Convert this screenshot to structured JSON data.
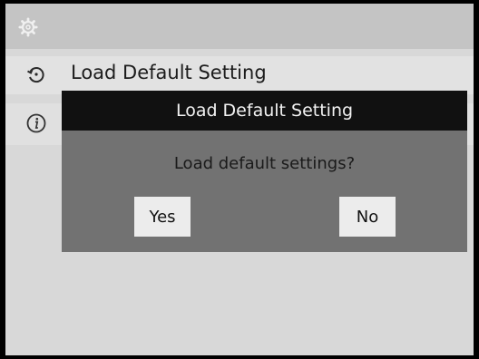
{
  "menu": {
    "items": [
      {
        "label": "Load Default Setting",
        "icon": "restore-icon"
      },
      {
        "label": "",
        "icon": "info-icon"
      }
    ],
    "header_icon": "gear-icon"
  },
  "dialog": {
    "title": "Load Default Setting",
    "message": "Load default settings?",
    "yes_label": "Yes",
    "no_label": "No"
  },
  "colors": {
    "dialog_header": "#111111",
    "dialog_body": "#727272",
    "button_bg": "#ececec",
    "screen_bg": "#d8d8d8"
  }
}
